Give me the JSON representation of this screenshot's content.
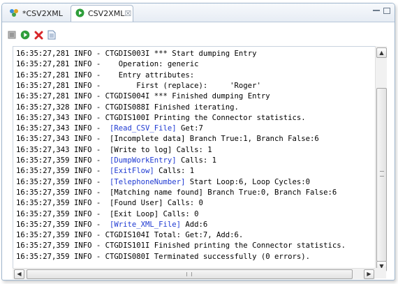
{
  "tabs": [
    {
      "label": "*CSV2XML",
      "icon": "assembly-line-icon",
      "active": false
    },
    {
      "label": "CSV2XML",
      "icon": "run-icon",
      "active": true,
      "close": "☒"
    }
  ],
  "toolbar": {
    "buttons": [
      {
        "name": "clear-console-button",
        "icon": "clear-icon"
      },
      {
        "name": "run-button",
        "icon": "run-icon"
      },
      {
        "name": "stop-button",
        "icon": "stop-icon"
      },
      {
        "name": "open-log-button",
        "icon": "document-icon"
      }
    ]
  },
  "colors": {
    "link": "#1f3ad2",
    "run_green": "#2e9e3a",
    "stop_red": "#d8262a"
  },
  "log": [
    {
      "ts": "16:35:27,281",
      "level": "INFO",
      "pre": " - ",
      "link": "",
      "msg": "CTGDIS003I *** Start dumping Entry"
    },
    {
      "ts": "16:35:27,281",
      "level": "INFO",
      "pre": " -    ",
      "link": "",
      "msg": "Operation: generic"
    },
    {
      "ts": "16:35:27,281",
      "level": "INFO",
      "pre": " -    ",
      "link": "",
      "msg": "Entry attributes:"
    },
    {
      "ts": "16:35:27,281",
      "level": "INFO",
      "pre": " -        ",
      "link": "",
      "msg": "First (replace):     'Roger'"
    },
    {
      "ts": "16:35:27,281",
      "level": "INFO",
      "pre": " - ",
      "link": "",
      "msg": "CTGDIS004I *** Finished dumping Entry"
    },
    {
      "ts": "16:35:27,328",
      "level": "INFO",
      "pre": " - ",
      "link": "",
      "msg": "CTGDIS088I Finished iterating."
    },
    {
      "ts": "16:35:27,343",
      "level": "INFO",
      "pre": " - ",
      "link": "",
      "msg": "CTGDIS100I Printing the Connector statistics."
    },
    {
      "ts": "16:35:27,343",
      "level": "INFO",
      "pre": " -  ",
      "link": "[Read_CSV_File]",
      "msg": " Get:7"
    },
    {
      "ts": "16:35:27,343",
      "level": "INFO",
      "pre": " -  ",
      "link": "",
      "msg": "[Incomplete data] Branch True:1, Branch False:6"
    },
    {
      "ts": "16:35:27,343",
      "level": "INFO",
      "pre": " -  ",
      "link": "",
      "msg": "[Write to log] Calls: 1"
    },
    {
      "ts": "16:35:27,359",
      "level": "INFO",
      "pre": " -  ",
      "link": "[DumpWorkEntry]",
      "msg": " Calls: 1"
    },
    {
      "ts": "16:35:27,359",
      "level": "INFO",
      "pre": " -  ",
      "link": "[ExitFlow]",
      "msg": " Calls: 1"
    },
    {
      "ts": "16:35:27,359",
      "level": "INFO",
      "pre": " -  ",
      "link": "[TelephoneNumber]",
      "msg": " Start Loop:6, Loop Cycles:0"
    },
    {
      "ts": "16:35:27,359",
      "level": "INFO",
      "pre": " -  ",
      "link": "",
      "msg": "[Matching name found] Branch True:0, Branch False:6"
    },
    {
      "ts": "16:35:27,359",
      "level": "INFO",
      "pre": " -  ",
      "link": "",
      "msg": "[Found User] Calls: 0"
    },
    {
      "ts": "16:35:27,359",
      "level": "INFO",
      "pre": " -  ",
      "link": "",
      "msg": "[Exit Loop] Calls: 0"
    },
    {
      "ts": "16:35:27,359",
      "level": "INFO",
      "pre": " -  ",
      "link": "[Write_XML_File]",
      "msg": " Add:6"
    },
    {
      "ts": "16:35:27,359",
      "level": "INFO",
      "pre": " - ",
      "link": "",
      "msg": "CTGDIS104I Total: Get:7, Add:6."
    },
    {
      "ts": "16:35:27,359",
      "level": "INFO",
      "pre": " - ",
      "link": "",
      "msg": "CTGDIS101I Finished printing the Connector statistics."
    },
    {
      "ts": "16:35:27,359",
      "level": "INFO",
      "pre": " - ",
      "link": "",
      "msg": "CTGDIS080I Terminated successfully (0 errors)."
    }
  ]
}
